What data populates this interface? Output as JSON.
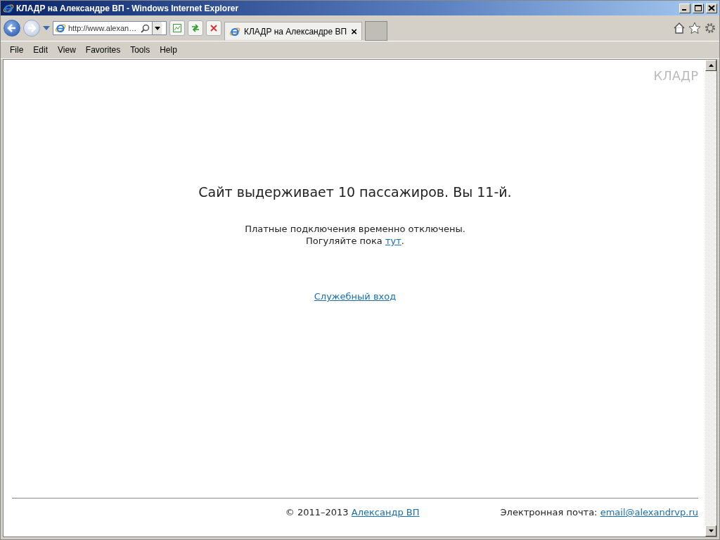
{
  "window": {
    "title": "КЛАДР на Александре ВП - Windows Internet Explorer"
  },
  "address": {
    "value": "http://www.alexan…"
  },
  "tabs": [
    {
      "label": "КЛАДР на Александре ВП",
      "selected": true,
      "close": "×"
    }
  ],
  "menu": [
    "File",
    "Edit",
    "View",
    "Favorites",
    "Tools",
    "Help"
  ],
  "page": {
    "logo": "КЛАДР",
    "heading": "Сайт выдерживает 10 пассажиров. Вы 11-й.",
    "notice": "Платные подключения временно отключены.",
    "walk_text": "Погуляйте пока ",
    "walk_link": "тут",
    "walk_end": ".",
    "service_link": "Служебный вход"
  },
  "footer": {
    "copyright": "© 2011–2013 ",
    "author_link": "Александр ВП",
    "email_label": "Электронная почта: ",
    "email_link": "email@alexandrvp.ru"
  }
}
